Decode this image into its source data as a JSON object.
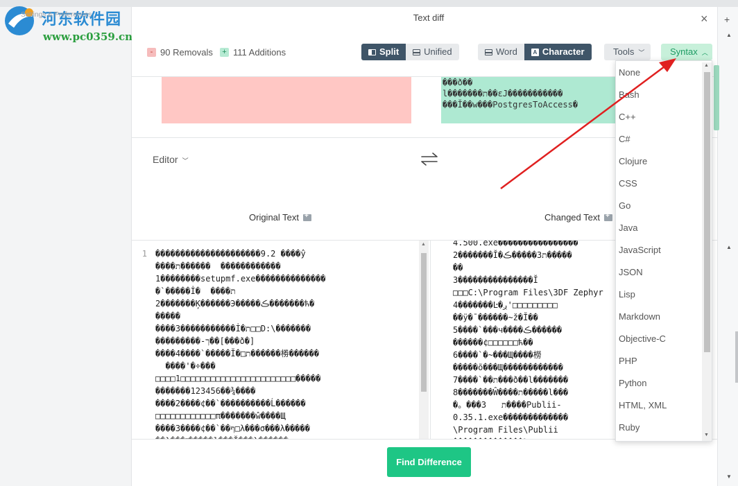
{
  "watermark": {
    "title": "河东软件园",
    "url": "www.pc0359.cn",
    "crumb": "Settings & Preferences"
  },
  "window": {
    "title": "Text diff",
    "close": "×"
  },
  "stats": {
    "removals": "90 Removals",
    "additions": "111 Additions",
    "minus": "-",
    "plus": "+"
  },
  "view_toggle": {
    "split": "Split",
    "unified": "Unified",
    "active": "Split"
  },
  "diff_level": {
    "word": "Word",
    "character": "Character",
    "active": "Character"
  },
  "tools": {
    "label": "Tools"
  },
  "syntax": {
    "label": "Syntax",
    "options": [
      "None",
      "Bash",
      "C++",
      "C#",
      "Clojure",
      "CSS",
      "Go",
      "Java",
      "JavaScript",
      "JSON",
      "Lisp",
      "Markdown",
      "Objective-C",
      "PHP",
      "Python",
      "HTML, XML",
      "Ruby"
    ]
  },
  "top_added": "���ð��\nl�������ת��ɛJ�����������\n���Ĭ��w���PostgresToAccess�",
  "editor": {
    "label": "Editor"
  },
  "left_pane": {
    "title": "Original Text",
    "line_number": "1",
    "content": "���������������������9.2 ����ŷ\n����ת������  ������������\n1��������setupmf.exe��������������\n�`�����İ�  ����ת\n2�������Ķ������Э�����ڪ�������ћ�\n�����\n����3�����������İ�ת□□D:\\�������\n���������-ך��[���ð�]\n����4����`�����Ĭ�□ת������椦������\n  ����'�÷���\n□□□□1□□□□□□□□□□□□□□□□□□□□□□□�����\n�������123456��¾����\n����2����¢��`����������Ĺ������\n□□□□□□□□□□□□π�������ŵ����Щ\n����3����¢��`��ף□λ���σ���λ�����\n��λ���˭�����ɬ���Ĭ���λ������"
  },
  "right_pane": {
    "title": "Changed Text",
    "content": "4.500.exe����������������\n2�������Ĭ�ת3�����ڪ�����\n��\n3���������������Ĭ\n□□□C:\\Program Files\\3DF Zephyr\n4�������Ŀ�ږ'□□□□□□□□□\n��ÿ�¯������~ž�Ĭ��\n5����`���ч����ڪ������\n������¢□□□□□□ћ��\n6����`�~���Щ����橯\n�����õ���Щ������������\n7����`��ת���ð��l�������\n8�������Ŵ����ת�����l���\n�。���3   ת����Publii-\n0.35.1.exe�������������\n\\Program Files\\Publii\n��������������λ□□□□□□□"
  },
  "find_button": {
    "label": "Find Difference"
  }
}
